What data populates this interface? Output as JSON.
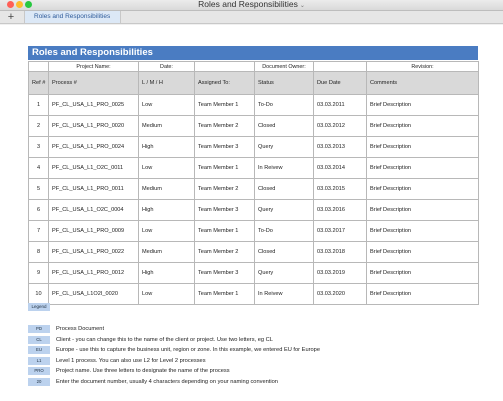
{
  "window": {
    "title": "Roles and Responsibilities",
    "title_chevron": "⌄"
  },
  "tabbar": {
    "add_label": "+",
    "active_tab": "Roles and Responsibilities"
  },
  "sheet": {
    "title": "Roles and Responsibilities",
    "meta": {
      "project_name": "Project Name:",
      "date": "Date:",
      "document_owner": "Document Owner:",
      "revision": "Revision:"
    },
    "columns": [
      "Ref #",
      "Process #",
      "L / M / H",
      "Assigned To:",
      "Status",
      "Due Date",
      "Comments"
    ],
    "rows": [
      {
        "ref": "1",
        "process": "PF_CL_USA_L1_PRO_0025",
        "lmh": "Low",
        "assigned": "Team Member 1",
        "status": "To-Do",
        "due": "03.03.2011",
        "comments": "Brief Description"
      },
      {
        "ref": "2",
        "process": "PF_CL_USA_L1_PRO_0020",
        "lmh": "Medium",
        "assigned": "Team Member 2",
        "status": "Closed",
        "due": "03.03.2012",
        "comments": "Brief Description"
      },
      {
        "ref": "3",
        "process": "PF_CL_USA_L1_PRO_0024",
        "lmh": "High",
        "assigned": "Team Member 3",
        "status": "Query",
        "due": "03.03.2013",
        "comments": "Brief Description"
      },
      {
        "ref": "4",
        "process": "PF_CL_USA_L1_O2C_0011",
        "lmh": "Low",
        "assigned": "Team Member 1",
        "status": "In Reivew",
        "due": "03.03.2014",
        "comments": "Brief Description"
      },
      {
        "ref": "5",
        "process": "PF_CL_USA_L1_PRO_0011",
        "lmh": "Medium",
        "assigned": "Team Member 2",
        "status": "Closed",
        "due": "03.03.2015",
        "comments": "Brief Description"
      },
      {
        "ref": "6",
        "process": "PF_CL_USA_L1_O2C_0004",
        "lmh": "High",
        "assigned": "Team Member 3",
        "status": "Query",
        "due": "03.03.2016",
        "comments": "Brief Description"
      },
      {
        "ref": "7",
        "process": "PF_CL_USA_L1_PRO_0009",
        "lmh": "Low",
        "assigned": "Team Member 1",
        "status": "To-Do",
        "due": "03.03.2017",
        "comments": "Brief Description"
      },
      {
        "ref": "8",
        "process": "PF_CL_USA_L1_PRO_0022",
        "lmh": "Medium",
        "assigned": "Team Member 2",
        "status": "Closed",
        "due": "03.03.2018",
        "comments": "Brief Description"
      },
      {
        "ref": "9",
        "process": "PF_CL_USA_L1_PRO_0012",
        "lmh": "High",
        "assigned": "Team Member 3",
        "status": "Query",
        "due": "03.03.2019",
        "comments": "Brief Description"
      },
      {
        "ref": "10",
        "process": "PF_CL_USA_L1O2I_0020",
        "lmh": "Low",
        "assigned": "Team Member 1",
        "status": "In Reivew",
        "due": "03.03.2020",
        "comments": "Brief Description"
      }
    ],
    "legend_label": "Legend",
    "legend": [
      {
        "code": "PD",
        "text": "Process Document"
      },
      {
        "code": "CL",
        "text": "Client - you can change this to the name of the client or project. Use two letters, eg CL"
      },
      {
        "code": "EU",
        "text": "Europe - use this to capture the business unit, region or zone. In this example, we entered EU for Europe"
      },
      {
        "code": "L1",
        "text": "Level 1 process. You can also use L2 for Level 2 processes"
      },
      {
        "code": "PRO",
        "text": "Project name. Use three letters to designate the name of the process"
      },
      {
        "code": "20",
        "text": "Enter the document number, usually 4 characters depending on your naming convention"
      }
    ]
  }
}
